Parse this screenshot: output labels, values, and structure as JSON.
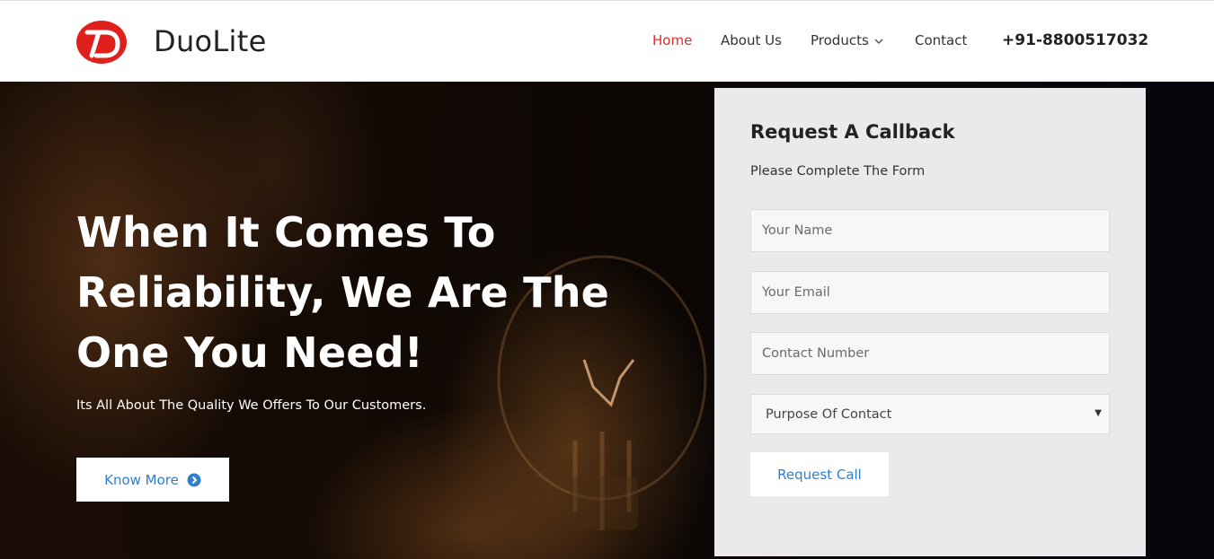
{
  "header": {
    "brand": "DuoLite",
    "nav": {
      "home": "Home",
      "about": "About Us",
      "products": "Products",
      "contact": "Contact"
    },
    "phone": "+91-8800517032",
    "accent_color": "#d9302c"
  },
  "hero": {
    "title": "When It Comes To Reliability, We Are The One You Need!",
    "subtitle": "Its All About The Quality We Offers To Our Customers.",
    "cta_label": "Know More",
    "cta_icon": "arrow-circle-right-icon"
  },
  "form": {
    "title": "Request A Callback",
    "subtitle": "Please Complete The Form",
    "name_placeholder": "Your Name",
    "email_placeholder": "Your Email",
    "phone_placeholder": "Contact Number",
    "purpose_selected": "Purpose Of Contact",
    "submit_label": "Request Call",
    "button_text_color": "#2f7fd1"
  }
}
